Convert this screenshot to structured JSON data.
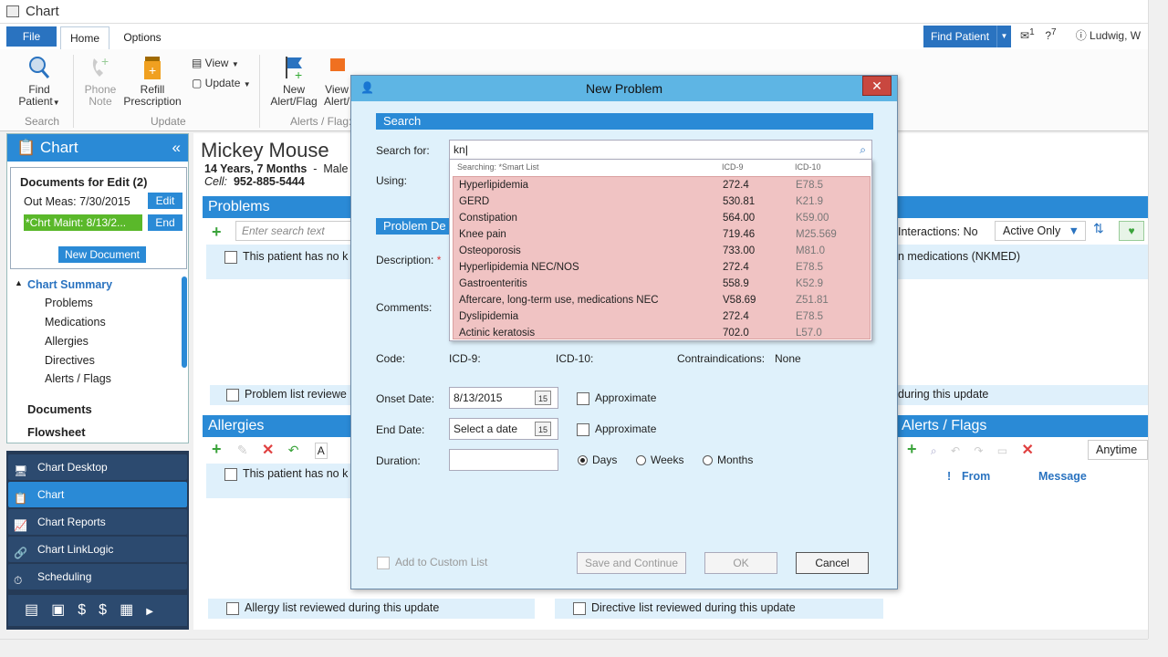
{
  "window": {
    "title": "Chart"
  },
  "ribbon": {
    "tabs": {
      "file": "File",
      "home": "Home",
      "options": "Options"
    },
    "find_patient_button": "Find Patient",
    "user_name": "Ludwig, W",
    "counts": {
      "msg": "1",
      "help": "7"
    },
    "buttons": {
      "find_patient": "Find\nPatient",
      "phone_note": "Phone\nNote",
      "refill": "Refill\nPrescription",
      "view": "View",
      "update": "Update",
      "new_alert": "New\nAlert/Flag",
      "view_alert": "View\nAlert/"
    },
    "groups": {
      "search": "Search",
      "update": "Update",
      "alerts": "Alerts / Flag:"
    }
  },
  "left_panel": {
    "header": "Chart",
    "docs_title": "Documents for Edit (2)",
    "doc1": "Out Meas: 7/30/2015",
    "doc1_btn": "Edit",
    "doc2": "*Chrt Maint: 8/13/2...",
    "doc2_btn": "End",
    "new_doc_btn": "New Document",
    "chart_summary": "Chart Summary",
    "nav": [
      "Problems",
      "Medications",
      "Allergies",
      "Directives",
      "Alerts / Flags"
    ],
    "documents": "Documents",
    "flowsheet": "Flowsheet"
  },
  "bottom_nav": [
    "Chart Desktop",
    "Chart",
    "Chart Reports",
    "Chart LinkLogic",
    "Scheduling"
  ],
  "patient": {
    "name": "Mickey Mouse",
    "age": "14 Years, 7 Months",
    "sex": "Male",
    "cell_label": "Cell:",
    "cell": "952-885-5444"
  },
  "problems": {
    "title": "Problems",
    "search_placeholder": "Enter search text",
    "none_text": "This patient has no k",
    "reviewed": "Problem list reviewe"
  },
  "medications": {
    "interactions": "Interactions:  No",
    "filter": "Active Only",
    "nkmed": "n medications (NKMED)",
    "reviewed": "during this update"
  },
  "allergies": {
    "title": "Allergies",
    "none_text": "This patient has no k",
    "reviewed": "Allergy list reviewed during this update",
    "filter": "A"
  },
  "directives": {
    "reviewed": "Directive list reviewed during this update"
  },
  "alerts": {
    "title": "Alerts / Flags",
    "filter": "Anytime",
    "col_priority": "!",
    "col_from": "From",
    "col_message": "Message"
  },
  "dialog": {
    "title": "New Problem",
    "section_search": "Search",
    "search_for_label": "Search for:",
    "search_value": "kn",
    "using_label": "Using:",
    "section_problem": "Problem De",
    "description_label": "Description:",
    "comments_label": "Comments:",
    "code_label": "Code:",
    "icd9_label": "ICD-9:",
    "icd10_label": "ICD-10:",
    "contra_label": "Contraindications:",
    "contra_value": "None",
    "onset_label": "Onset Date:",
    "onset_value": "8/13/2015",
    "end_label": "End Date:",
    "end_placeholder": "Select a date",
    "approx_label": "Approximate",
    "duration_label": "Duration:",
    "days": "Days",
    "weeks": "Weeks",
    "months": "Months",
    "add_custom": "Add to Custom List",
    "save_continue": "Save and Continue",
    "ok": "OK",
    "cancel": "Cancel",
    "cal_day": "15",
    "dropdown": {
      "searching": "Searching: *Smart List",
      "col_icd9": "ICD-9",
      "col_icd10": "ICD-10",
      "rows": [
        {
          "desc": "Hyperlipidemia",
          "icd9": "272.4",
          "icd10": "E78.5"
        },
        {
          "desc": "GERD",
          "icd9": "530.81",
          "icd10": "K21.9"
        },
        {
          "desc": "Constipation",
          "icd9": "564.00",
          "icd10": "K59.00"
        },
        {
          "desc": "Knee pain",
          "icd9": "719.46",
          "icd10": "M25.569"
        },
        {
          "desc": "Osteoporosis",
          "icd9": "733.00",
          "icd10": "M81.0"
        },
        {
          "desc": "Hyperlipidemia NEC/NOS",
          "icd9": "272.4",
          "icd10": "E78.5"
        },
        {
          "desc": "Gastroenteritis",
          "icd9": "558.9",
          "icd10": "K52.9"
        },
        {
          "desc": "Aftercare, long-term use, medications NEC",
          "icd9": "V58.69",
          "icd10": "Z51.81"
        },
        {
          "desc": "Dyslipidemia",
          "icd9": "272.4",
          "icd10": "E78.5"
        },
        {
          "desc": "Actinic keratosis",
          "icd9": "702.0",
          "icd10": "L57.0"
        }
      ]
    }
  },
  "colors": {
    "accent": "#2a8ad6",
    "dropdown_bg": "#f0c3c3",
    "close": "#c9473f"
  }
}
